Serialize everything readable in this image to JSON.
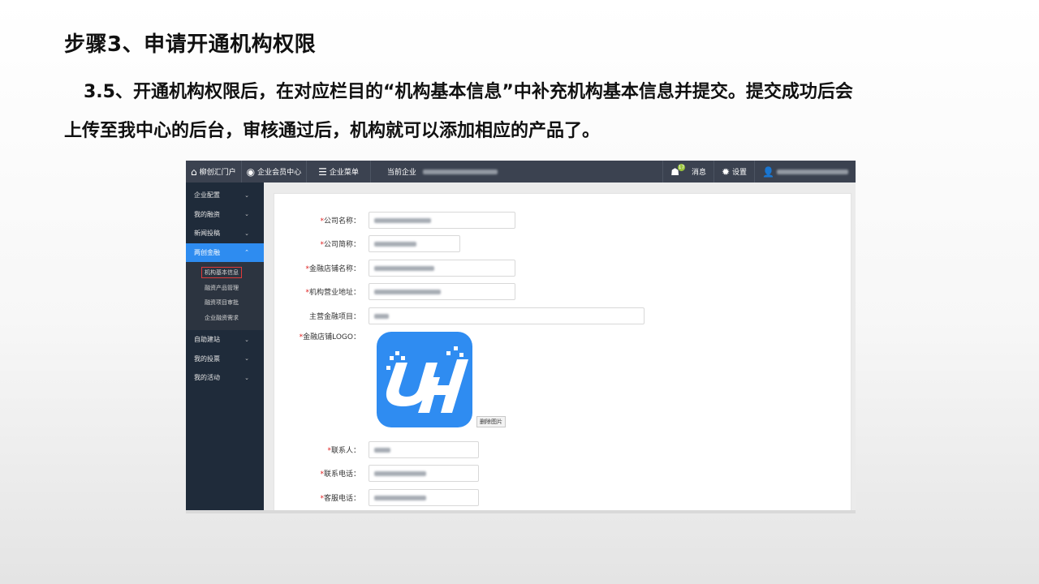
{
  "slide": {
    "title": "步骤3、申请开通机构权限",
    "line1": "3.5、开通机构权限后，在对应栏目的“机构基本信息”中补充机构基本信息并提交。提交成功后会",
    "line2": "上传至我中心的后台，审核通过后，机构就可以添加相应的产品了。"
  },
  "topbar": {
    "portal": "柳创汇门户",
    "member_center": "企业会员中心",
    "menu": "企业菜单",
    "current_company_label": "当前企业",
    "message": "消息",
    "message_count": "17",
    "settings": "设置"
  },
  "sidebar": {
    "items": [
      {
        "label": "企业配置"
      },
      {
        "label": "我的融资"
      },
      {
        "label": "新闻投稿"
      },
      {
        "label": "两创金融"
      },
      {
        "label": "自助建站"
      },
      {
        "label": "我的投票"
      },
      {
        "label": "我的活动"
      }
    ],
    "sub_items": [
      {
        "label": "机构基本信息"
      },
      {
        "label": "融资产品管理"
      },
      {
        "label": "融资项目审批"
      },
      {
        "label": "企业融资需求"
      }
    ]
  },
  "form": {
    "fields": [
      {
        "label": "公司名称：",
        "required": true
      },
      {
        "label": "公司简称：",
        "required": true
      },
      {
        "label": "金融店铺名称：",
        "required": true
      },
      {
        "label": "机构营业地址：",
        "required": true
      },
      {
        "label": "主营金融项目：",
        "required": false
      },
      {
        "label": "金融店铺LOGO：",
        "required": true
      },
      {
        "label": "联系人：",
        "required": true
      },
      {
        "label": "联系电话：",
        "required": true
      },
      {
        "label": "客服电话：",
        "required": true
      }
    ],
    "required_mark": "*",
    "delete_image_label": "删除图片"
  },
  "colors": {
    "topbar": "#3b4250",
    "sidebar": "#1f2b3a",
    "active": "#2e8cf0",
    "logo_bg": "#2f8cf1",
    "required": "#e02020"
  }
}
